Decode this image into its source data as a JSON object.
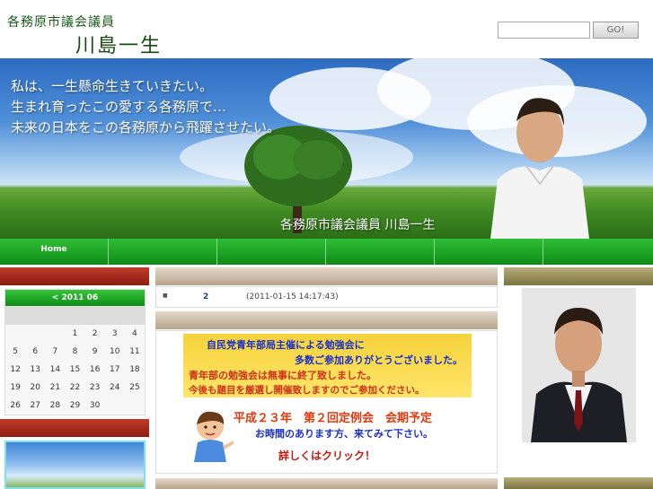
{
  "header": {
    "subtitle": "各務原市議会議員",
    "name": "川島一生",
    "search_placeholder": "",
    "go_label": "GO!"
  },
  "banner": {
    "lines": [
      "私は、一生懸命生きていきたい。",
      "生まれ育ったこの愛する各務原で…",
      "未来の日本をこの各務原から飛躍させたい。"
    ],
    "caption": "各務原市議会議員  川島一生"
  },
  "nav": {
    "items": [
      "Home",
      "",
      "",
      "",
      "",
      ""
    ]
  },
  "calendar": {
    "header": "< 2011 06",
    "rows": [
      [
        "",
        "",
        "",
        "1",
        "2",
        "3",
        "4"
      ],
      [
        "5",
        "6",
        "7",
        "8",
        "9",
        "10",
        "11"
      ],
      [
        "12",
        "13",
        "14",
        "15",
        "16",
        "17",
        "18"
      ],
      [
        "19",
        "20",
        "21",
        "22",
        "23",
        "24",
        "25"
      ],
      [
        "26",
        "27",
        "28",
        "29",
        "30",
        "",
        ""
      ]
    ]
  },
  "entry": {
    "bullet": "■",
    "title": "2",
    "date": "(2011-01-15 14:17:43)"
  },
  "promo": {
    "line1": "自民党青年部局主催による勉強会に",
    "line2": "多数ご参加ありがとうございました。",
    "line3": "青年部の勉強会は無事に終了致しました。",
    "line4": "今後も題目を厳選し開催致しますのでご参加ください。",
    "title": "平成２３年　第２回定例会　会期予定",
    "sub": "お時間のあります方、来てみて下さい。",
    "link": "詳しくはクリック！"
  },
  "colors": {
    "nav_green": "#119a1b",
    "side_red": "#a82c1c",
    "center_tan": "#c9b8a0",
    "right_olive": "#9a9260",
    "promo_yellow": "#f6d23a"
  }
}
